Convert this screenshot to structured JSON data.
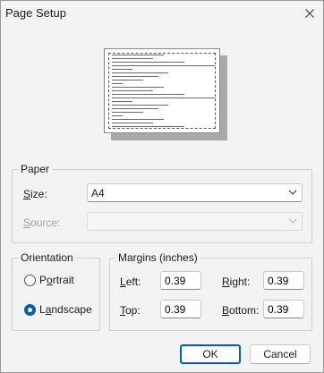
{
  "window": {
    "title": "Page Setup"
  },
  "paper": {
    "group_label": "Paper",
    "size_label_u": "S",
    "size_label_rest": "ize:",
    "size_value": "A4",
    "source_label_u": "S",
    "source_label_rest": "ource:",
    "source_value": ""
  },
  "orientation": {
    "group_label": "Orientation",
    "portrait_label_u": "o",
    "portrait_pre": "P",
    "portrait_post": "rtrait",
    "landscape_label_u": "a",
    "landscape_pre": "L",
    "landscape_post": "ndscape",
    "selected": "landscape"
  },
  "margins": {
    "group_label": "Margins (inches)",
    "left_label_u": "L",
    "left_label_rest": "eft:",
    "left_value": "0.39",
    "right_label_u": "R",
    "right_label_rest": "ight:",
    "right_value": "0.39",
    "top_label_u": "T",
    "top_label_rest": "op:",
    "top_value": "0.39",
    "bottom_label_u": "B",
    "bottom_label_rest": "ottom:",
    "bottom_value": "0.39"
  },
  "buttons": {
    "ok": "OK",
    "cancel": "Cancel"
  },
  "icons": {
    "close": "close-icon",
    "dropdown": "chevron-down-icon"
  }
}
